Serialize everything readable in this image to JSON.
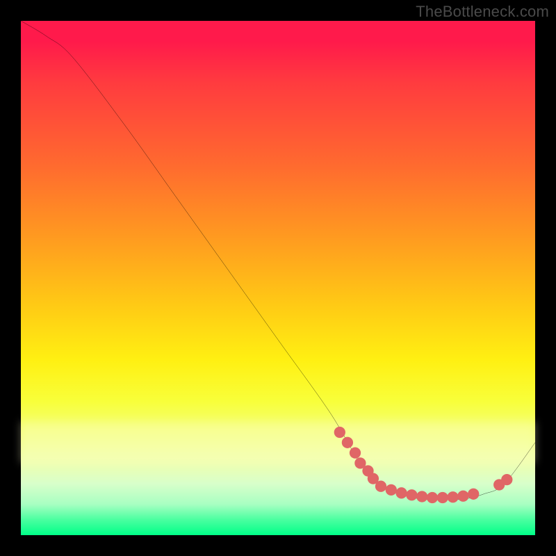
{
  "watermark": "TheBottleneck.com",
  "chart_data": {
    "type": "line",
    "title": "",
    "xlabel": "",
    "ylabel": "",
    "xlim": [
      0,
      100
    ],
    "ylim": [
      0,
      100
    ],
    "grid": false,
    "series": [
      {
        "name": "curve",
        "color": "#000000",
        "x": [
          0,
          5,
          10,
          20,
          30,
          40,
          50,
          60,
          66,
          70,
          74,
          78,
          82,
          86,
          90,
          94,
          100
        ],
        "y": [
          100,
          97,
          93,
          80,
          66,
          52,
          38,
          24,
          14,
          10,
          8,
          7,
          7,
          7,
          8,
          10,
          18
        ]
      },
      {
        "name": "dots-left-cluster",
        "type": "scatter",
        "color": "#e06666",
        "x": [
          62,
          63.5,
          65,
          66,
          67.5,
          68.5
        ],
        "y": [
          20,
          18,
          16,
          14,
          12.5,
          11
        ]
      },
      {
        "name": "dots-bottom-run",
        "type": "scatter",
        "color": "#e06666",
        "x": [
          70,
          72,
          74,
          76,
          78,
          80,
          82,
          84,
          86,
          88
        ],
        "y": [
          9.5,
          8.8,
          8.2,
          7.8,
          7.5,
          7.3,
          7.3,
          7.4,
          7.6,
          8.0
        ]
      },
      {
        "name": "dots-right-cluster",
        "type": "scatter",
        "color": "#e06666",
        "x": [
          93,
          94.5
        ],
        "y": [
          9.8,
          10.8
        ]
      }
    ],
    "background": {
      "type": "vertical-gradient",
      "stops": [
        {
          "pos": 0.0,
          "color": "#ff1a4b"
        },
        {
          "pos": 0.28,
          "color": "#ff6a2f"
        },
        {
          "pos": 0.55,
          "color": "#ffc915"
        },
        {
          "pos": 0.74,
          "color": "#f8ff3a"
        },
        {
          "pos": 0.9,
          "color": "#d8ffca"
        },
        {
          "pos": 1.0,
          "color": "#00ff88"
        }
      ]
    }
  }
}
